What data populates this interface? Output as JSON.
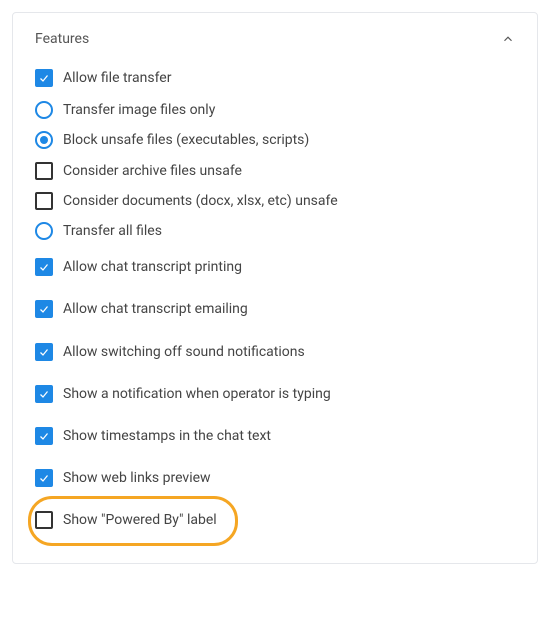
{
  "panel": {
    "title": "Features",
    "expanded": true
  },
  "features": {
    "allow_file_transfer": {
      "label": "Allow file transfer",
      "checked": true,
      "options": {
        "transfer_image_only": {
          "label": "Transfer image files only",
          "selected": false
        },
        "block_unsafe": {
          "label": "Block unsafe files (executables, scripts)",
          "selected": true,
          "sub": {
            "archive_unsafe": {
              "label": "Consider archive files unsafe",
              "checked": false
            },
            "documents_unsafe": {
              "label": "Consider documents (docx, xlsx, etc) unsafe",
              "checked": false
            }
          }
        },
        "transfer_all": {
          "label": "Transfer all files",
          "selected": false
        }
      }
    },
    "allow_transcript_print": {
      "label": "Allow chat transcript printing",
      "checked": true
    },
    "allow_transcript_email": {
      "label": "Allow chat transcript emailing",
      "checked": true
    },
    "allow_sound_off": {
      "label": "Allow switching off sound notifications",
      "checked": true
    },
    "typing_notification": {
      "label": "Show a notification when operator is typing",
      "checked": true
    },
    "show_timestamps": {
      "label": "Show timestamps in the chat text",
      "checked": true
    },
    "web_links_preview": {
      "label": "Show web links preview",
      "checked": true
    },
    "powered_by": {
      "label": "Show \"Powered By\" label",
      "checked": false
    }
  },
  "colors": {
    "accent": "#1e88e5",
    "highlight": "#f5a623"
  }
}
